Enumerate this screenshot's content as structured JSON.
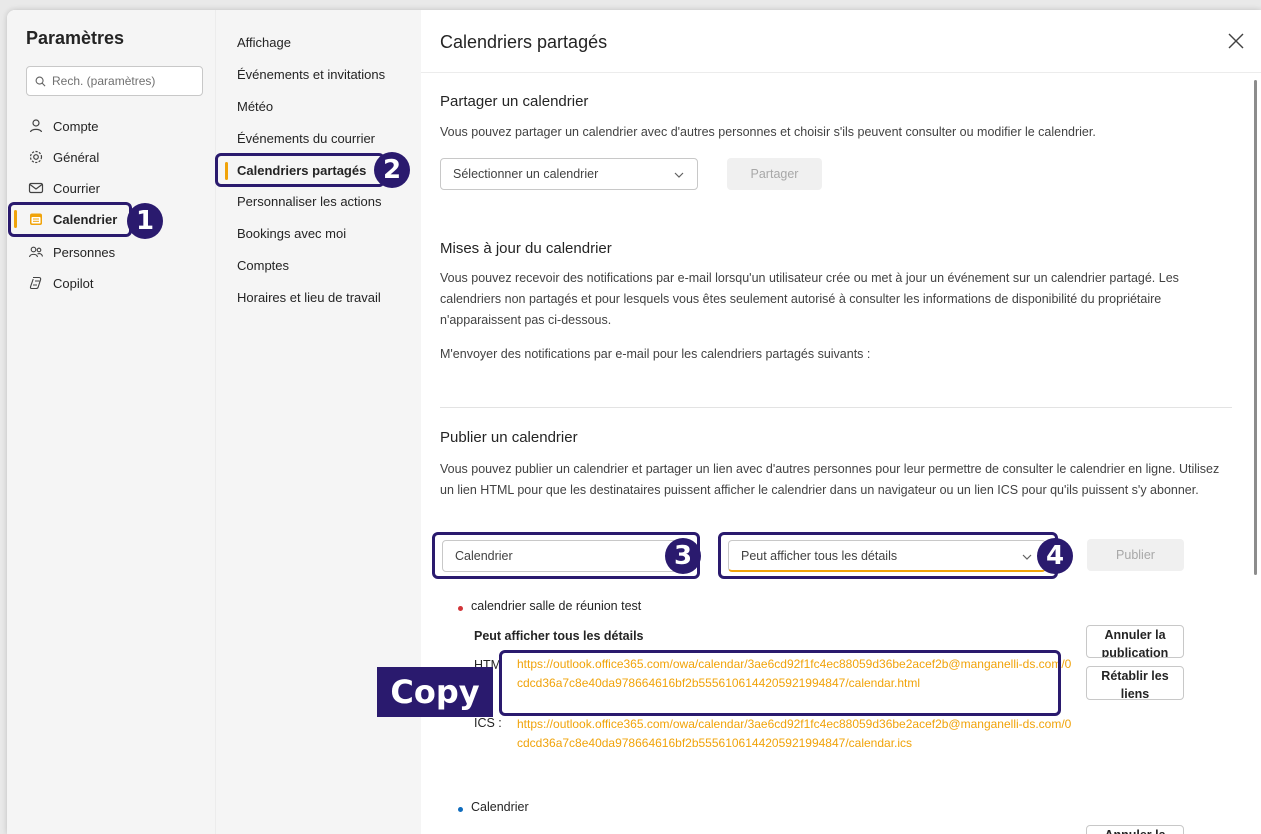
{
  "settings": {
    "title": "Paramètres",
    "search_placeholder": "Rech. (paramètres)",
    "nav": [
      {
        "label": "Compte",
        "icon": "person-icon"
      },
      {
        "label": "Général",
        "icon": "gear-icon"
      },
      {
        "label": "Courrier",
        "icon": "mail-icon"
      },
      {
        "label": "Calendrier",
        "icon": "calendar-icon",
        "active": true
      },
      {
        "label": "Personnes",
        "icon": "people-icon"
      },
      {
        "label": "Copilot",
        "icon": "copilot-icon"
      }
    ]
  },
  "submenu": [
    {
      "label": "Affichage"
    },
    {
      "label": "Événements et invitations"
    },
    {
      "label": "Météo"
    },
    {
      "label": "Événements du courrier"
    },
    {
      "label": "Calendriers partagés",
      "active": true
    },
    {
      "label": "Personnaliser les actions"
    },
    {
      "label": "Bookings avec moi"
    },
    {
      "label": "Comptes"
    },
    {
      "label": "Horaires et lieu de travail"
    }
  ],
  "main": {
    "title": "Calendriers partagés",
    "share": {
      "heading": "Partager un calendrier",
      "desc": "Vous pouvez partager un calendrier avec d'autres personnes et choisir s'ils peuvent consulter ou modifier le calendrier.",
      "select_placeholder": "Sélectionner un calendrier",
      "share_button": "Partager"
    },
    "updates": {
      "heading": "Mises à jour du calendrier",
      "desc": "Vous pouvez recevoir des notifications par e-mail lorsqu'un utilisateur crée ou met à jour un événement sur un calendrier partagé. Les calendriers non partagés et pour lesquels vous êtes seulement autorisé à consulter les informations de disponibilité du propriétaire n'apparaissent pas ci-dessous.",
      "notify_label": "M'envoyer des notifications par e-mail pour les calendriers partagés suivants :"
    },
    "publish": {
      "heading": "Publier un calendrier",
      "desc": "Vous pouvez publier un calendrier et partager un lien avec d'autres personnes pour leur permettre de consulter le calendrier en ligne. Utilisez un lien HTML pour que les destinataires puissent afficher le calendrier dans un navigateur ou un lien ICS pour qu'ils puissent s'y abonner.",
      "calendar_select": "Calendrier",
      "permission_select": "Peut afficher tous les détails",
      "publish_button": "Publier",
      "published": [
        {
          "name": "calendrier salle de réunion test",
          "dot_color": "#d13438",
          "permission": "Peut afficher tous les détails",
          "html_label": "HTM",
          "html_link": "https://outlook.office365.com/owa/calendar/3ae6cd92f1fc4ec88059d36be2acef2b@manganelli-ds.com/0cdcd36a7c8e40da978664616bf2b5556106144205921994847/calendar.html",
          "ics_label": "ICS :",
          "ics_link": "https://outlook.office365.com/owa/calendar/3ae6cd92f1fc4ec88059d36be2acef2b@manganelli-ds.com/0cdcd36a7c8e40da978664616bf2b5556106144205921994847/calendar.ics",
          "unpublish_button": "Annuler la publication",
          "reset_button": "Rétablir les liens"
        },
        {
          "name": "Calendrier",
          "dot_color": "#0f6cbd",
          "unpublish_button": "Annuler la"
        }
      ]
    }
  },
  "annotations": {
    "badges": [
      "1",
      "2",
      "3",
      "4"
    ],
    "copy_label": "Copy"
  },
  "colors": {
    "accent": "#f0a30a",
    "callout": "#2a1a6e"
  }
}
